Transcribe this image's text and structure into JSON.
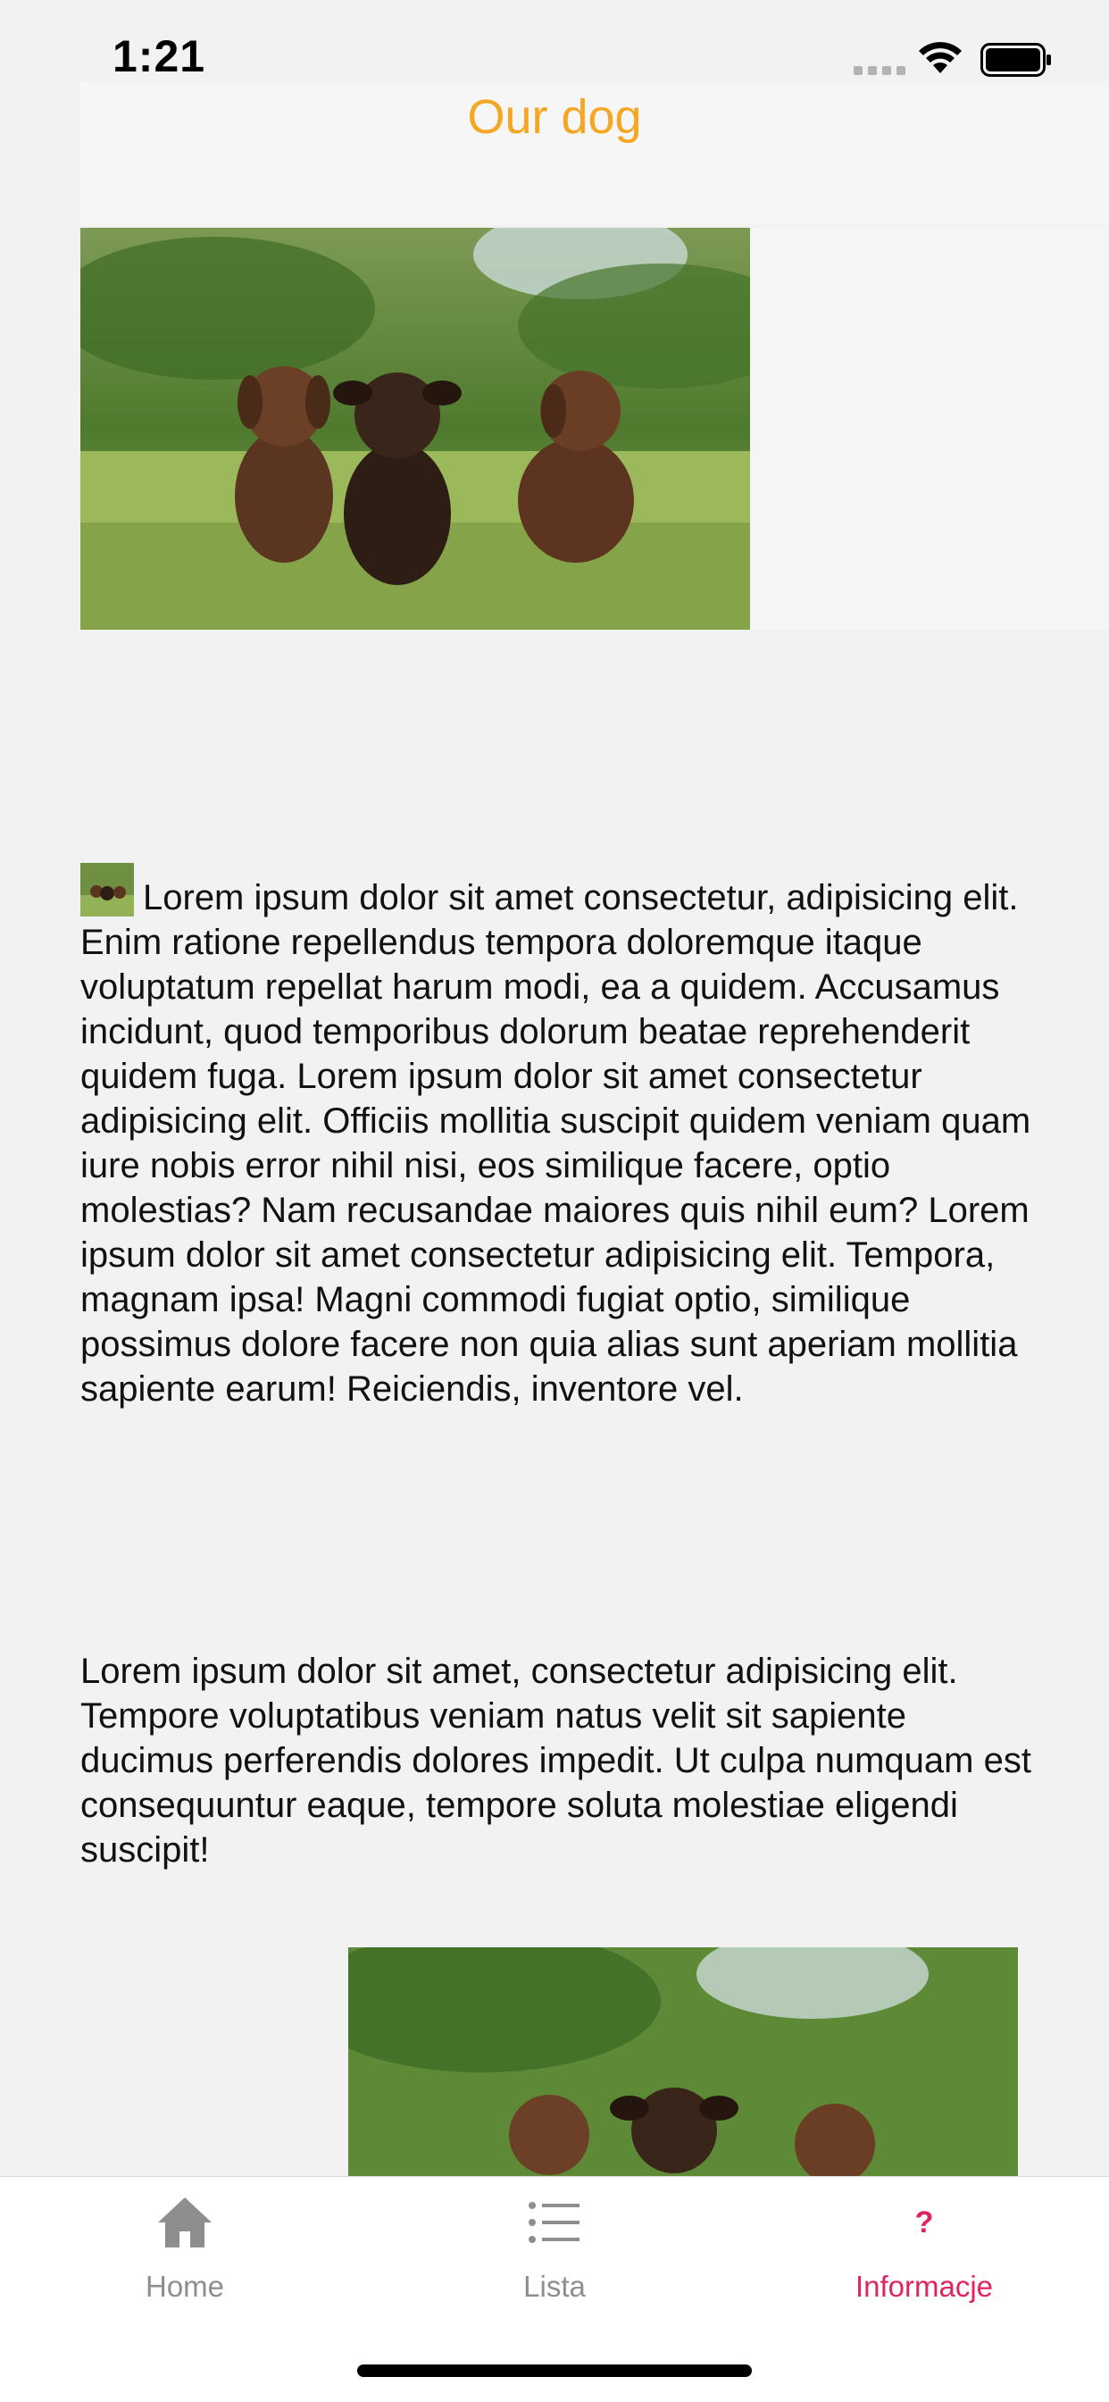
{
  "status_bar": {
    "time": "1:21"
  },
  "header": {
    "title": "Our dog"
  },
  "paragraph_1": "Lorem ipsum dolor sit amet consectetur, adipisicing elit. Enim ratione repellendus tempora doloremque itaque voluptatum repellat harum modi, ea a quidem. Accusamus incidunt, quod temporibus dolorum beatae reprehenderit quidem fuga. Lorem ipsum dolor sit amet consectetur adipisicing elit. Officiis mollitia suscipit quidem veniam quam iure nobis error nihil nisi, eos similique facere, optio molestias? Nam recusandae maiores quis nihil eum? Lorem ipsum dolor sit amet consectetur adipisicing elit. Tempora, magnam ipsa! Magni commodi fugiat optio, similique possimus dolore facere non quia alias sunt aperiam mollitia sapiente earum! Reiciendis, inventore vel.",
  "paragraph_2": "Lorem ipsum dolor sit amet, consectetur adipisicing elit. Tempore voluptatibus veniam natus velit sit sapiente ducimus perferendis dolores impedit. Ut culpa numquam est consequuntur eaque, tempore soluta molestiae eligendi suscipit!",
  "tab_bar": {
    "tabs": [
      {
        "label": "Home",
        "icon": "home-icon",
        "active": false
      },
      {
        "label": "Lista",
        "icon": "list-icon",
        "active": false
      },
      {
        "label": "Informacje",
        "icon": "question-icon",
        "active": true
      }
    ]
  },
  "colors": {
    "title": "#f5a623",
    "active_tab": "#e0245e",
    "inactive_tab": "#8e8e8e"
  }
}
